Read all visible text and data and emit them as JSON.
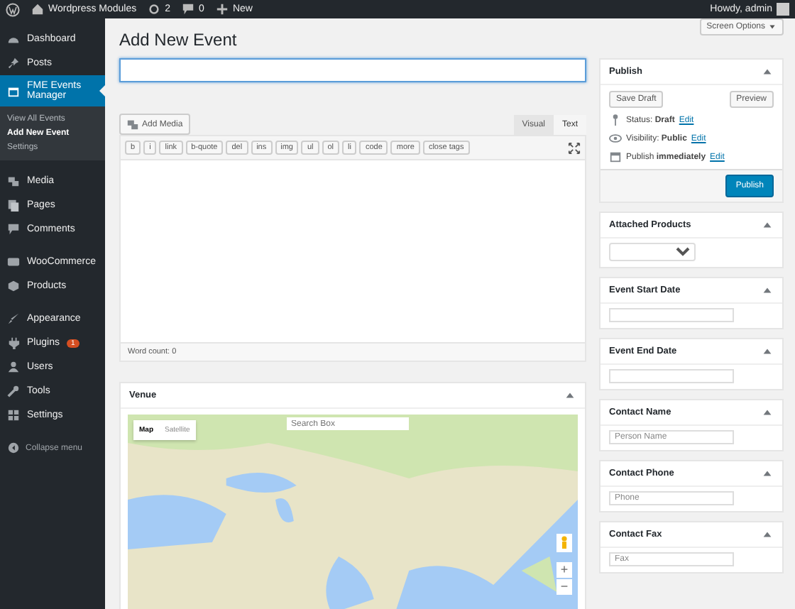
{
  "admin_bar": {
    "site_name": "Wordpress Modules",
    "updates": "2",
    "comments": "0",
    "new": "New",
    "greeting": "Howdy, admin"
  },
  "sidebar": {
    "groups": [
      [
        {
          "label": "Dashboard",
          "selected": false
        },
        {
          "label": "Posts",
          "selected": false
        },
        {
          "label": "FME Events Manager",
          "selected": true,
          "submenu": [
            {
              "label": "View All Events",
              "selected": false
            },
            {
              "label": "Add New Event",
              "selected": true
            },
            {
              "label": "Settings",
              "selected": false
            }
          ]
        }
      ],
      [
        {
          "label": "Media",
          "selected": false
        },
        {
          "label": "Pages",
          "selected": false
        },
        {
          "label": "Comments",
          "selected": false
        }
      ],
      [
        {
          "label": "WooCommerce",
          "selected": false
        },
        {
          "label": "Products",
          "selected": false
        }
      ],
      [
        {
          "label": "Appearance",
          "selected": false
        },
        {
          "label": "Plugins",
          "selected": false,
          "badge": "1"
        },
        {
          "label": "Users",
          "selected": false
        },
        {
          "label": "Tools",
          "selected": false
        },
        {
          "label": "Settings",
          "selected": false
        }
      ]
    ],
    "collapse": "Collapse menu"
  },
  "screen_options": "Screen Options",
  "title": "Add New Event",
  "editor": {
    "add_media": "Add Media",
    "tabs": [
      {
        "label": "Visual",
        "selected": false
      },
      {
        "label": "Text",
        "selected": true
      }
    ],
    "quicktags": [
      "b",
      "i",
      "link",
      "b-quote",
      "del",
      "ins",
      "img",
      "ul",
      "ol",
      "li",
      "code",
      "more",
      "close tags"
    ],
    "word_count": "Word count: 0"
  },
  "venue": {
    "title": "Venue",
    "map_types": [
      {
        "label": "Map",
        "selected": true
      },
      {
        "label": "Satellite",
        "selected": false
      }
    ],
    "search_placeholder": "Search Box",
    "zoom_in": "+",
    "zoom_out": "−"
  },
  "publish": {
    "title": "Publish",
    "save_draft": "Save Draft",
    "preview": "Preview",
    "rows": [
      {
        "text": "Status: **Draft**",
        "link": "Edit"
      },
      {
        "text": "Visibility: **Public**",
        "link": "Edit"
      },
      {
        "text": "Publish **immediately**",
        "link": "Edit"
      }
    ],
    "button": "Publish"
  },
  "side_boxes": [
    {
      "title": "Attached Products",
      "kind": "select"
    },
    {
      "title": "Event Start Date",
      "kind": "text"
    },
    {
      "title": "Event End Date",
      "kind": "text"
    },
    {
      "title": "Contact Name",
      "kind": "text",
      "placeholder": "Person Name"
    },
    {
      "title": "Contact Phone",
      "kind": "text",
      "placeholder": "Phone"
    },
    {
      "title": "Contact Fax",
      "kind": "text",
      "placeholder": "Fax"
    }
  ]
}
